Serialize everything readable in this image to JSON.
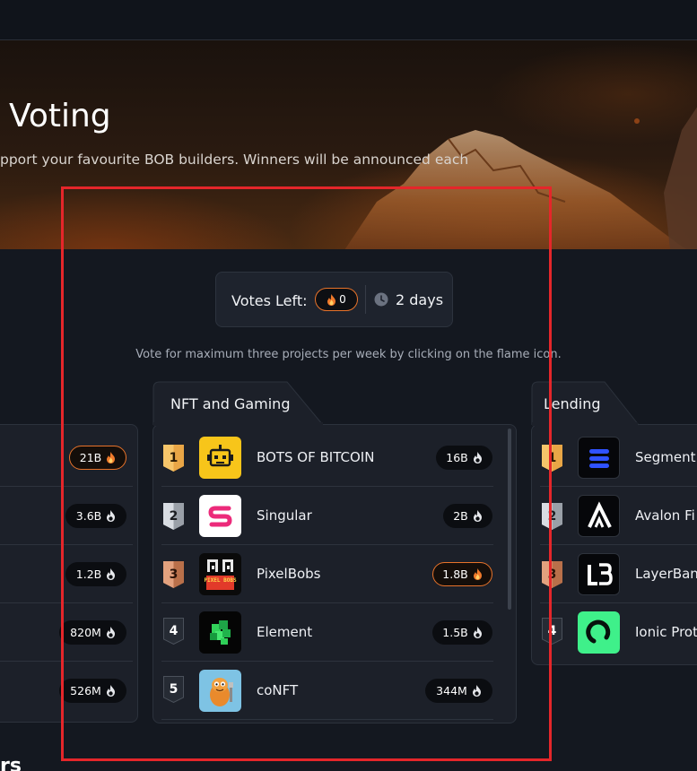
{
  "hero": {
    "title": "Voting",
    "subtitle": "pport your favourite BOB builders. Winners will be announced each"
  },
  "votes": {
    "label": "Votes Left:",
    "count": "0",
    "time_left": "2 days"
  },
  "instructions": "Vote for maximum three projects per week by clicking on the flame icon.",
  "left_column": {
    "rows": [
      {
        "votes": "21B",
        "hot": true
      },
      {
        "votes": "3.6B",
        "hot": false
      },
      {
        "votes": "1.2B",
        "hot": false
      },
      {
        "votes": "820M",
        "hot": false
      },
      {
        "votes": "526M",
        "hot": false
      }
    ]
  },
  "center_column": {
    "tab": "NFT and Gaming",
    "rows": [
      {
        "rank": "1",
        "medal": "gold",
        "name": "BOTS OF BITCOIN",
        "votes": "16B",
        "hot": false,
        "logo": "robot-logo"
      },
      {
        "rank": "2",
        "medal": "silver",
        "name": "Singular",
        "votes": "2B",
        "hot": false,
        "logo": "singular-s-logo"
      },
      {
        "rank": "3",
        "medal": "bronze",
        "name": "PixelBobs",
        "votes": "1.8B",
        "hot": true,
        "logo": "pixelbobs-logo",
        "logo_text": "PIXEL BOBS"
      },
      {
        "rank": "4",
        "medal": "plain",
        "name": "Element",
        "votes": "1.5B",
        "hot": false,
        "logo": "element-cube-logo"
      },
      {
        "rank": "5",
        "medal": "plain",
        "name": "coNFT",
        "votes": "344M",
        "hot": false,
        "logo": "conft-character-logo"
      }
    ]
  },
  "right_column": {
    "tab": "Lending",
    "rows": [
      {
        "rank": "1",
        "medal": "gold",
        "name": "Segment",
        "logo": "segment-logo"
      },
      {
        "rank": "2",
        "medal": "silver",
        "name": "Avalon Fi",
        "logo": "avalon-a-logo"
      },
      {
        "rank": "3",
        "medal": "bronze",
        "name": "LayerBank",
        "logo": "layerbank-logo"
      },
      {
        "rank": "4",
        "medal": "plain",
        "name": "Ionic Prot",
        "logo": "ionic-logo"
      }
    ]
  },
  "bottom_fragment": "rs",
  "colors": {
    "accent_flame": "#e8732a",
    "highlight_box": "#e5262a",
    "background": "#141820",
    "card": "#1c2029"
  }
}
